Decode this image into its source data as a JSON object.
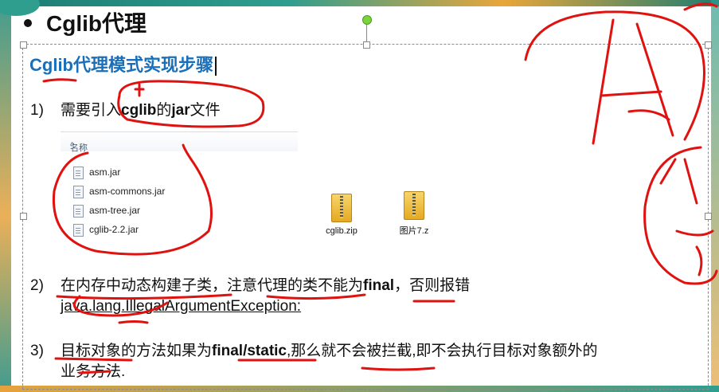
{
  "slide": {
    "title": "Cglib代理",
    "heading": "Cglib代理模式实现步骤",
    "steps": [
      {
        "num": "1)",
        "pre": "需要引入",
        "b1": "cglib",
        "mid": "的",
        "b2": "jar",
        "post": "文件"
      },
      {
        "num": "2)",
        "pre": "在内存中动态构建子类，注意代理的类不能为",
        "b1": "final",
        "post": "，否则报错",
        "line2": "java.lang.IllegalArgumentException:"
      },
      {
        "num": "3)",
        "pre": "目标对象的方法如果为",
        "b1": "final/static",
        "post": ",那么就不会被拦截,即不会执行目标对象额外的",
        "line2": "业务方法."
      }
    ]
  },
  "explorer": {
    "column_header": "名称",
    "files": [
      "asm.jar",
      "asm-commons.jar",
      "asm-tree.jar",
      "cglib-2.2.jar"
    ]
  },
  "archives": [
    {
      "name": "cglib.zip",
      "icon": "zip-archive-icon"
    },
    {
      "name": "图片7.z",
      "icon": "zip-archive-icon"
    }
  ],
  "colors": {
    "heading": "#1a6fb8",
    "annotation": "#e0120f",
    "rotation_handle": "#7bd33b"
  }
}
